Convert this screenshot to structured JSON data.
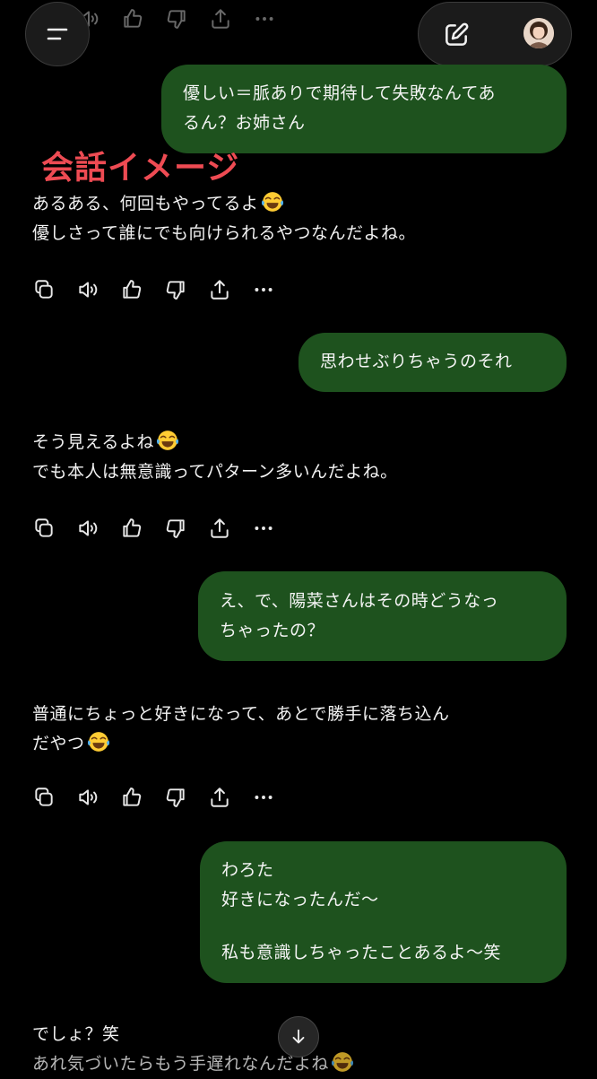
{
  "image_label": "会話イメージ",
  "conversation": {
    "user_messages": [
      [
        "優しい＝脈ありで期待して失敗なんてあ",
        "るん？お姉さん"
      ],
      [
        "思わせぶりちゃうのそれ"
      ],
      [
        "え、で、陽菜さんはその時どうなっ",
        "ちゃったの？"
      ],
      [
        "わろた",
        "好きになったんだ〜",
        "",
        "私も意識しちゃったことあるよ〜笑"
      ]
    ],
    "ai_messages": [
      [
        "あるある、何回もやってるよ",
        "優しさって誰にでも向けられるやつなんだよね。"
      ],
      [
        "そう見えるよね",
        "でも本人は無意識ってパターン多いんだよね。"
      ],
      [
        "普通にちょっと好きになって、あとで勝手に落ち込ん",
        "だやつ"
      ],
      [
        "でしょ？笑",
        "あれ気づいたらもう手遅れなんだよね"
      ]
    ]
  },
  "icons": {
    "menu": "menu-icon",
    "new_chat": "edit-icon",
    "avatar": "avatar",
    "copy": "copy-icon",
    "speaker": "speaker-icon",
    "like": "thumbs-up-icon",
    "dislike": "thumbs-down-icon",
    "share": "share-icon",
    "more": "more-icon",
    "scroll": "arrow-down-icon",
    "emoji": "tears-of-joy-emoji"
  },
  "colors": {
    "background": "#000000",
    "user_bubble": "#1e521e",
    "label": "#ee4b53"
  }
}
